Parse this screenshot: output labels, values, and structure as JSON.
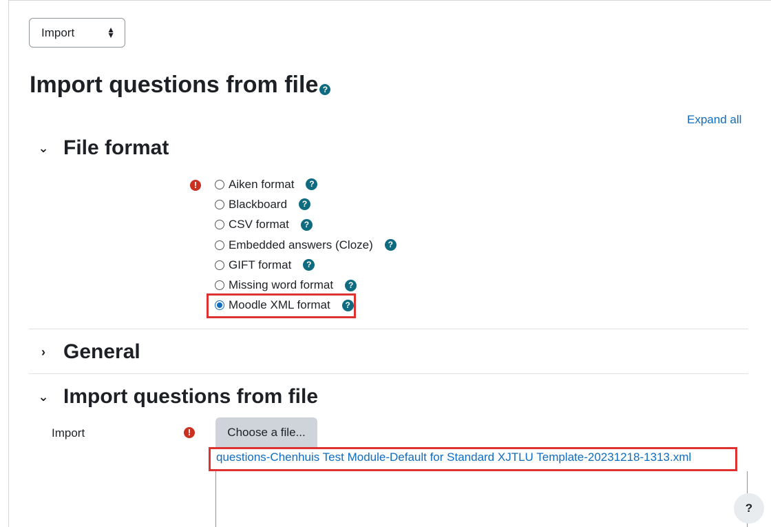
{
  "action_select": {
    "value": "Import",
    "arrow_icon": "up-down-arrows-icon"
  },
  "page": {
    "title": "Import questions from file",
    "expand_all": "Expand all"
  },
  "sections": {
    "file_format": {
      "title": "File format"
    },
    "general": {
      "title": "General"
    },
    "import_file": {
      "title": "Import questions from file"
    }
  },
  "formats": [
    {
      "label": "Aiken format",
      "selected": false
    },
    {
      "label": "Blackboard",
      "selected": false
    },
    {
      "label": "CSV format",
      "selected": false
    },
    {
      "label": "Embedded answers (Cloze)",
      "selected": false
    },
    {
      "label": "GIFT format",
      "selected": false
    },
    {
      "label": "Missing word format",
      "selected": false
    },
    {
      "label": "Moodle XML format",
      "selected": true
    }
  ],
  "import_field": {
    "label": "Import",
    "choose_button": "Choose a file...",
    "file_name": "questions-Chenhuis Test Module-Default for Standard XJTLU Template-20231218-1313.xml"
  },
  "help_fab": "?",
  "help_glyph": "?",
  "required_glyph": "!",
  "colors": {
    "link": "#0f6cbf",
    "required": "#ca3120",
    "help": "#0f6b80",
    "highlight": "#e03131"
  }
}
